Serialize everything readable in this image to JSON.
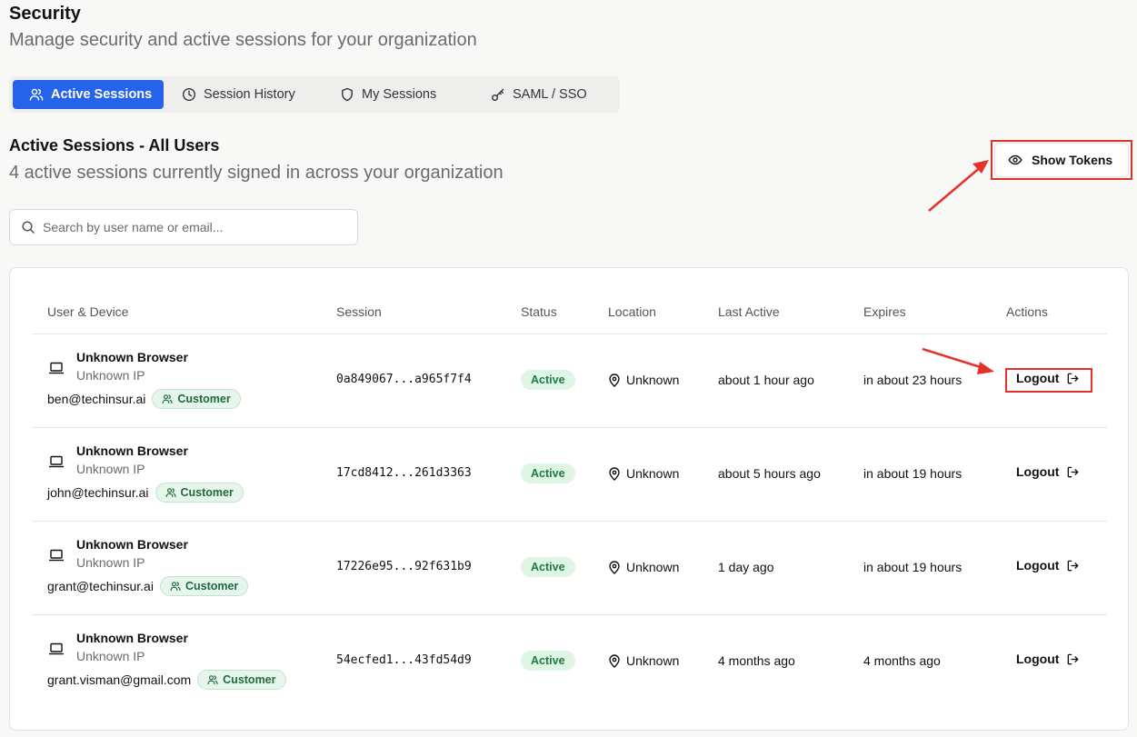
{
  "page": {
    "title": "Security",
    "subtitle": "Manage security and active sessions for your organization"
  },
  "tabs": [
    {
      "label": "Active Sessions",
      "icon": "users-icon",
      "active": true
    },
    {
      "label": "Session History",
      "icon": "clock-icon",
      "active": false
    },
    {
      "label": "My Sessions",
      "icon": "shield-icon",
      "active": false
    },
    {
      "label": "SAML / SSO",
      "icon": "key-icon",
      "active": false
    }
  ],
  "section": {
    "title": "Active Sessions - All Users",
    "subtitle": "4 active sessions currently signed in across your organization"
  },
  "show_tokens": {
    "label": "Show Tokens",
    "icon": "eye-icon"
  },
  "search": {
    "placeholder": "Search by user name or email...",
    "value": ""
  },
  "table": {
    "columns": [
      "User & Device",
      "Session",
      "Status",
      "Location",
      "Last Active",
      "Expires",
      "Actions"
    ],
    "rows": [
      {
        "browser": "Unknown Browser",
        "ip": "Unknown IP",
        "email": "ben@techinsur.ai",
        "role": "Customer",
        "session": "0a849067...a965f7f4",
        "status": "Active",
        "location": "Unknown",
        "last_active": "about 1 hour ago",
        "expires": "in about 23 hours",
        "action": "Logout"
      },
      {
        "browser": "Unknown Browser",
        "ip": "Unknown IP",
        "email": "john@techinsur.ai",
        "role": "Customer",
        "session": "17cd8412...261d3363",
        "status": "Active",
        "location": "Unknown",
        "last_active": "about 5 hours ago",
        "expires": "in about 19 hours",
        "action": "Logout"
      },
      {
        "browser": "Unknown Browser",
        "ip": "Unknown IP",
        "email": "grant@techinsur.ai",
        "role": "Customer",
        "session": "17226e95...92f631b9",
        "status": "Active",
        "location": "Unknown",
        "last_active": "1 day ago",
        "expires": "in about 19 hours",
        "action": "Logout"
      },
      {
        "browser": "Unknown Browser",
        "ip": "Unknown IP",
        "email": "grant.visman@gmail.com",
        "role": "Customer",
        "session": "54ecfed1...43fd54d9",
        "status": "Active",
        "location": "Unknown",
        "last_active": "4 months ago",
        "expires": "4 months ago",
        "action": "Logout"
      }
    ]
  },
  "colors": {
    "accent": "#2563eb",
    "annotation": "#e53228",
    "status_active_bg": "#dff5e6",
    "status_active_text": "#1f7a43"
  }
}
